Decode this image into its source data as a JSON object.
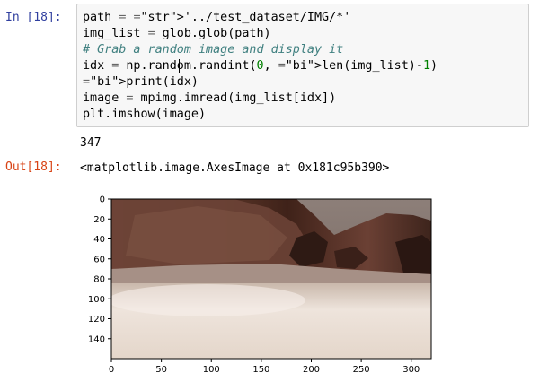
{
  "input_cell": {
    "prompt": "In [18]:",
    "lines": [
      "path = '../test_dataset/IMG/*'",
      "img_list = glob.glob(path)",
      "# Grab a random image and display it",
      "idx = np.random.randint(0, len(img_list)-1)",
      "print(idx)",
      "image = mpimg.imread(img_list[idx])",
      "plt.imshow(image)"
    ]
  },
  "stdout": "347",
  "output_cell": {
    "prompt": "Out[18]:",
    "text": "<matplotlib.image.AxesImage at 0x181c95b390>"
  },
  "plot": {
    "image_description_kind": "rover-camera-terrain",
    "colors": {
      "sky": "#7e6e66",
      "rock_dark": "#4a2c22",
      "rock_mid": "#6b4134",
      "sand": "#e8dcd2"
    },
    "x_ticks": [
      "0",
      "50",
      "100",
      "150",
      "200",
      "250",
      "300"
    ],
    "y_ticks": [
      "0",
      "20",
      "40",
      "60",
      "80",
      "100",
      "120",
      "140"
    ],
    "x_values": [
      0,
      50,
      100,
      150,
      200,
      250,
      300
    ],
    "y_values": [
      0,
      20,
      40,
      60,
      80,
      100,
      120,
      140
    ],
    "x_extent": [
      0,
      320
    ],
    "y_extent": [
      0,
      160
    ]
  },
  "syntax_colors": {
    "string": "#ba2121",
    "comment": "#408080",
    "number": "#008000",
    "builtin": "#008000",
    "in_prompt": "#303f9f",
    "out_prompt": "#d84315"
  }
}
